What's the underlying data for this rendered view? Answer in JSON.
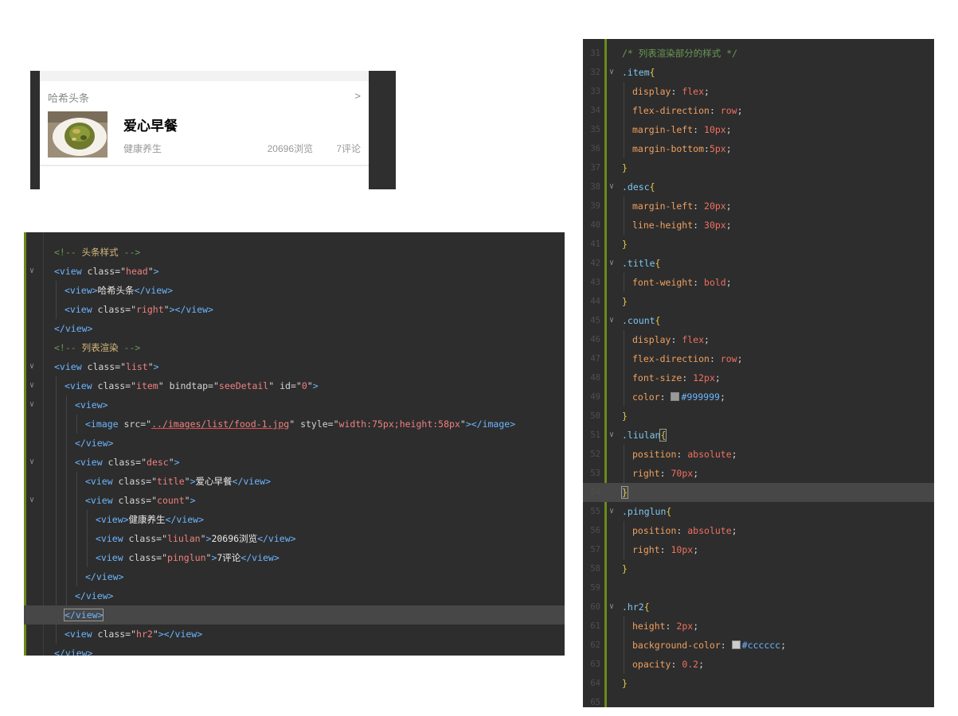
{
  "preview": {
    "head_title": "哈希头条",
    "head_right": ">",
    "item": {
      "title": "爱心早餐",
      "category": "健康养生",
      "views": "20696浏览",
      "comments": "7评论"
    }
  },
  "html_editor": {
    "lines": [
      {
        "indent": 0,
        "fold": false,
        "tokens": [
          [
            "c-comment",
            "<!-- "
          ],
          [
            "c-cmt-y",
            "头条样式"
          ],
          [
            "c-comment",
            " -->"
          ]
        ]
      },
      {
        "indent": 0,
        "fold": true,
        "tokens": [
          [
            "c-tag",
            "<view "
          ],
          [
            "c-attr",
            "class="
          ],
          [
            "c-punc",
            "\""
          ],
          [
            "c-str",
            "head"
          ],
          [
            "c-punc",
            "\""
          ],
          [
            "c-tag",
            ">"
          ]
        ]
      },
      {
        "indent": 1,
        "fold": false,
        "tokens": [
          [
            "c-tag",
            "<view>"
          ],
          [
            "c-text",
            "哈希头条"
          ],
          [
            "c-tag",
            "</view>"
          ]
        ]
      },
      {
        "indent": 1,
        "fold": false,
        "tokens": [
          [
            "c-tag",
            "<view "
          ],
          [
            "c-attr",
            "class="
          ],
          [
            "c-punc",
            "\""
          ],
          [
            "c-str",
            "right"
          ],
          [
            "c-punc",
            "\""
          ],
          [
            "c-tag",
            "></view>"
          ]
        ]
      },
      {
        "indent": 0,
        "fold": false,
        "tokens": [
          [
            "c-tag",
            "</view>"
          ]
        ]
      },
      {
        "indent": 0,
        "fold": false,
        "tokens": [
          [
            "c-comment",
            "<!-- "
          ],
          [
            "c-cmt-y",
            "列表渲染"
          ],
          [
            "c-comment",
            " -->"
          ]
        ]
      },
      {
        "indent": 0,
        "fold": true,
        "tokens": [
          [
            "c-tag",
            "<view "
          ],
          [
            "c-attr",
            "class="
          ],
          [
            "c-punc",
            "\""
          ],
          [
            "c-str",
            "list"
          ],
          [
            "c-punc",
            "\""
          ],
          [
            "c-tag",
            ">"
          ]
        ]
      },
      {
        "indent": 1,
        "fold": true,
        "tokens": [
          [
            "c-tag",
            "<view "
          ],
          [
            "c-attr",
            "class="
          ],
          [
            "c-punc",
            "\""
          ],
          [
            "c-str",
            "item"
          ],
          [
            "c-punc",
            "\""
          ],
          [
            "c-attr",
            " bindtap="
          ],
          [
            "c-punc",
            "\""
          ],
          [
            "c-str",
            "seeDetail"
          ],
          [
            "c-punc",
            "\""
          ],
          [
            "c-attr",
            " id="
          ],
          [
            "c-punc",
            "\""
          ],
          [
            "c-str",
            "0"
          ],
          [
            "c-punc",
            "\""
          ],
          [
            "c-tag",
            ">"
          ]
        ]
      },
      {
        "indent": 2,
        "fold": true,
        "tokens": [
          [
            "c-tag",
            "<view>"
          ]
        ]
      },
      {
        "indent": 3,
        "fold": false,
        "tokens": [
          [
            "c-tag",
            "<image "
          ],
          [
            "c-attr",
            "src="
          ],
          [
            "c-punc",
            "\""
          ],
          [
            "c-str u-red",
            "../images/list/food-1.jpg"
          ],
          [
            "c-punc",
            "\""
          ],
          [
            "c-attr",
            " style="
          ],
          [
            "c-punc",
            "\""
          ],
          [
            "c-str",
            "width:75px;height:58px"
          ],
          [
            "c-punc",
            "\""
          ],
          [
            "c-tag",
            "></image>"
          ]
        ]
      },
      {
        "indent": 2,
        "fold": false,
        "tokens": [
          [
            "c-tag",
            "</view>"
          ]
        ]
      },
      {
        "indent": 2,
        "fold": true,
        "tokens": [
          [
            "c-tag",
            "<view "
          ],
          [
            "c-attr",
            "class="
          ],
          [
            "c-punc",
            "\""
          ],
          [
            "c-str",
            "desc"
          ],
          [
            "c-punc",
            "\""
          ],
          [
            "c-tag",
            ">"
          ]
        ]
      },
      {
        "indent": 3,
        "fold": false,
        "tokens": [
          [
            "c-tag",
            "<view "
          ],
          [
            "c-attr",
            "class="
          ],
          [
            "c-punc",
            "\""
          ],
          [
            "c-str",
            "title"
          ],
          [
            "c-punc",
            "\""
          ],
          [
            "c-tag",
            ">"
          ],
          [
            "c-text",
            "爱心早餐"
          ],
          [
            "c-tag",
            "</view>"
          ]
        ]
      },
      {
        "indent": 3,
        "fold": true,
        "tokens": [
          [
            "c-tag",
            "<view "
          ],
          [
            "c-attr",
            "class="
          ],
          [
            "c-punc",
            "\""
          ],
          [
            "c-str",
            "count"
          ],
          [
            "c-punc",
            "\""
          ],
          [
            "c-tag",
            ">"
          ]
        ]
      },
      {
        "indent": 4,
        "fold": false,
        "tokens": [
          [
            "c-tag",
            "<view>"
          ],
          [
            "c-text",
            "健康养生"
          ],
          [
            "c-tag",
            "</view>"
          ]
        ]
      },
      {
        "indent": 4,
        "fold": false,
        "tokens": [
          [
            "c-tag",
            "<view "
          ],
          [
            "c-attr",
            "class="
          ],
          [
            "c-punc",
            "\""
          ],
          [
            "c-str",
            "liulan"
          ],
          [
            "c-punc",
            "\""
          ],
          [
            "c-tag",
            ">"
          ],
          [
            "c-text",
            "20696浏览"
          ],
          [
            "c-tag",
            "</view>"
          ]
        ]
      },
      {
        "indent": 4,
        "fold": false,
        "tokens": [
          [
            "c-tag",
            "<view "
          ],
          [
            "c-attr",
            "class="
          ],
          [
            "c-punc",
            "\""
          ],
          [
            "c-str",
            "pinglun"
          ],
          [
            "c-punc",
            "\""
          ],
          [
            "c-tag",
            ">"
          ],
          [
            "c-text",
            "7评论"
          ],
          [
            "c-tag",
            "</view>"
          ]
        ]
      },
      {
        "indent": 3,
        "fold": false,
        "tokens": [
          [
            "c-tag",
            "</view>"
          ]
        ]
      },
      {
        "indent": 2,
        "fold": false,
        "tokens": [
          [
            "c-tag",
            "</view>"
          ]
        ]
      },
      {
        "indent": 1,
        "fold": false,
        "current": true,
        "tokens": [
          [
            "c-tag bracket-box",
            "</view>"
          ]
        ]
      },
      {
        "indent": 1,
        "fold": false,
        "tokens": [
          [
            "c-tag",
            "<view "
          ],
          [
            "c-attr",
            "class="
          ],
          [
            "c-punc",
            "\""
          ],
          [
            "c-str",
            "hr2"
          ],
          [
            "c-punc",
            "\""
          ],
          [
            "c-tag",
            "></view>"
          ]
        ]
      },
      {
        "indent": 0,
        "fold": false,
        "tokens": [
          [
            "c-tag",
            "</view>"
          ]
        ]
      }
    ]
  },
  "css_editor": {
    "first_line_number": 31,
    "lines": [
      {
        "indent": 0,
        "fold": false,
        "tokens": [
          [
            "c-comment",
            "/* 列表渲染部分的样式 */"
          ]
        ]
      },
      {
        "indent": 0,
        "fold": true,
        "tokens": [
          [
            "c-sel",
            ".item"
          ],
          [
            "c-brace",
            "{"
          ]
        ]
      },
      {
        "indent": 1,
        "fold": false,
        "tokens": [
          [
            "c-prop",
            "display"
          ],
          [
            "c-punc",
            ": "
          ],
          [
            "c-val",
            "flex"
          ],
          [
            "c-punc",
            ";"
          ]
        ]
      },
      {
        "indent": 1,
        "fold": false,
        "tokens": [
          [
            "c-prop",
            "flex-direction"
          ],
          [
            "c-punc",
            ": "
          ],
          [
            "c-val",
            "row"
          ],
          [
            "c-punc",
            ";"
          ]
        ]
      },
      {
        "indent": 1,
        "fold": false,
        "tokens": [
          [
            "c-prop",
            "margin-left"
          ],
          [
            "c-punc",
            ": "
          ],
          [
            "c-val",
            "10px"
          ],
          [
            "c-punc",
            ";"
          ]
        ]
      },
      {
        "indent": 1,
        "fold": false,
        "tokens": [
          [
            "c-prop",
            "margin-bottom"
          ],
          [
            "c-punc",
            ":"
          ],
          [
            "c-val",
            "5px"
          ],
          [
            "c-punc",
            ";"
          ]
        ]
      },
      {
        "indent": 0,
        "fold": false,
        "tokens": [
          [
            "c-brace",
            "}"
          ]
        ]
      },
      {
        "indent": 0,
        "fold": true,
        "tokens": [
          [
            "c-sel",
            ".desc"
          ],
          [
            "c-brace",
            "{"
          ]
        ]
      },
      {
        "indent": 1,
        "fold": false,
        "tokens": [
          [
            "c-prop",
            "margin-left"
          ],
          [
            "c-punc",
            ": "
          ],
          [
            "c-val",
            "20px"
          ],
          [
            "c-punc",
            ";"
          ]
        ]
      },
      {
        "indent": 1,
        "fold": false,
        "tokens": [
          [
            "c-prop",
            "line-height"
          ],
          [
            "c-punc",
            ": "
          ],
          [
            "c-val",
            "30px"
          ],
          [
            "c-punc",
            ";"
          ]
        ]
      },
      {
        "indent": 0,
        "fold": false,
        "tokens": [
          [
            "c-brace",
            "}"
          ]
        ]
      },
      {
        "indent": 0,
        "fold": true,
        "tokens": [
          [
            "c-sel",
            ".title"
          ],
          [
            "c-brace",
            "{"
          ]
        ]
      },
      {
        "indent": 1,
        "fold": false,
        "tokens": [
          [
            "c-prop",
            "font-weight"
          ],
          [
            "c-punc",
            ": "
          ],
          [
            "c-val",
            "bold"
          ],
          [
            "c-punc",
            ";"
          ]
        ]
      },
      {
        "indent": 0,
        "fold": false,
        "tokens": [
          [
            "c-brace",
            "}"
          ]
        ]
      },
      {
        "indent": 0,
        "fold": true,
        "tokens": [
          [
            "c-sel",
            ".count"
          ],
          [
            "c-brace",
            "{"
          ]
        ]
      },
      {
        "indent": 1,
        "fold": false,
        "tokens": [
          [
            "c-prop",
            "display"
          ],
          [
            "c-punc",
            ": "
          ],
          [
            "c-val",
            "flex"
          ],
          [
            "c-punc",
            ";"
          ]
        ]
      },
      {
        "indent": 1,
        "fold": false,
        "tokens": [
          [
            "c-prop",
            "flex-direction"
          ],
          [
            "c-punc",
            ": "
          ],
          [
            "c-val",
            "row"
          ],
          [
            "c-punc",
            ";"
          ]
        ]
      },
      {
        "indent": 1,
        "fold": false,
        "tokens": [
          [
            "c-prop",
            "font-size"
          ],
          [
            "c-punc",
            ": "
          ],
          [
            "c-val",
            "12px"
          ],
          [
            "c-punc",
            ";"
          ]
        ]
      },
      {
        "indent": 1,
        "fold": false,
        "swatch": "#999999",
        "tokens": [
          [
            "c-prop",
            "color"
          ],
          [
            "c-punc",
            ": "
          ],
          [
            "swatch",
            ""
          ],
          [
            "c-hex",
            "#999999"
          ],
          [
            "c-punc",
            ";"
          ]
        ]
      },
      {
        "indent": 0,
        "fold": false,
        "tokens": [
          [
            "c-brace",
            "}"
          ]
        ]
      },
      {
        "indent": 0,
        "fold": true,
        "tokens": [
          [
            "c-sel",
            ".liulan"
          ],
          [
            "c-brace bracket-box",
            "{"
          ]
        ]
      },
      {
        "indent": 1,
        "fold": false,
        "tokens": [
          [
            "c-prop",
            "position"
          ],
          [
            "c-punc",
            ": "
          ],
          [
            "c-val",
            "absolute"
          ],
          [
            "c-punc",
            ";"
          ]
        ]
      },
      {
        "indent": 1,
        "fold": false,
        "tokens": [
          [
            "c-prop",
            "right"
          ],
          [
            "c-punc",
            ": "
          ],
          [
            "c-val",
            "70px"
          ],
          [
            "c-punc",
            ";"
          ]
        ]
      },
      {
        "indent": 0,
        "fold": false,
        "current": true,
        "tokens": [
          [
            "c-brace bracket-box",
            "}"
          ]
        ]
      },
      {
        "indent": 0,
        "fold": true,
        "tokens": [
          [
            "c-sel",
            ".pinglun"
          ],
          [
            "c-brace",
            "{"
          ]
        ]
      },
      {
        "indent": 1,
        "fold": false,
        "tokens": [
          [
            "c-prop",
            "position"
          ],
          [
            "c-punc",
            ": "
          ],
          [
            "c-val",
            "absolute"
          ],
          [
            "c-punc",
            ";"
          ]
        ]
      },
      {
        "indent": 1,
        "fold": false,
        "tokens": [
          [
            "c-prop",
            "right"
          ],
          [
            "c-punc",
            ": "
          ],
          [
            "c-val",
            "10px"
          ],
          [
            "c-punc",
            ";"
          ]
        ]
      },
      {
        "indent": 0,
        "fold": false,
        "tokens": [
          [
            "c-brace",
            "}"
          ]
        ]
      },
      {
        "indent": 0,
        "fold": false,
        "tokens": []
      },
      {
        "indent": 0,
        "fold": true,
        "tokens": [
          [
            "c-sel",
            ".hr2"
          ],
          [
            "c-brace",
            "{"
          ]
        ]
      },
      {
        "indent": 1,
        "fold": false,
        "tokens": [
          [
            "c-prop",
            "height"
          ],
          [
            "c-punc",
            ": "
          ],
          [
            "c-val",
            "2px"
          ],
          [
            "c-punc",
            ";"
          ]
        ]
      },
      {
        "indent": 1,
        "fold": false,
        "swatch": "#cccccc",
        "tokens": [
          [
            "c-prop",
            "background-color"
          ],
          [
            "c-punc",
            ": "
          ],
          [
            "swatch",
            ""
          ],
          [
            "c-hex",
            "#cccccc"
          ],
          [
            "c-punc",
            ";"
          ]
        ]
      },
      {
        "indent": 1,
        "fold": false,
        "tokens": [
          [
            "c-prop",
            "opacity"
          ],
          [
            "c-punc",
            ": "
          ],
          [
            "c-val",
            "0.2"
          ],
          [
            "c-punc",
            ";"
          ]
        ]
      },
      {
        "indent": 0,
        "fold": false,
        "tokens": [
          [
            "c-brace",
            "}"
          ]
        ]
      },
      {
        "indent": 0,
        "fold": false,
        "tokens": []
      }
    ]
  },
  "colors": {
    "editor_bg": "#2d2d2d",
    "gutter_bar": "#6a8a1a",
    "count_text": "#999999",
    "hr2_color": "#cccccc"
  }
}
